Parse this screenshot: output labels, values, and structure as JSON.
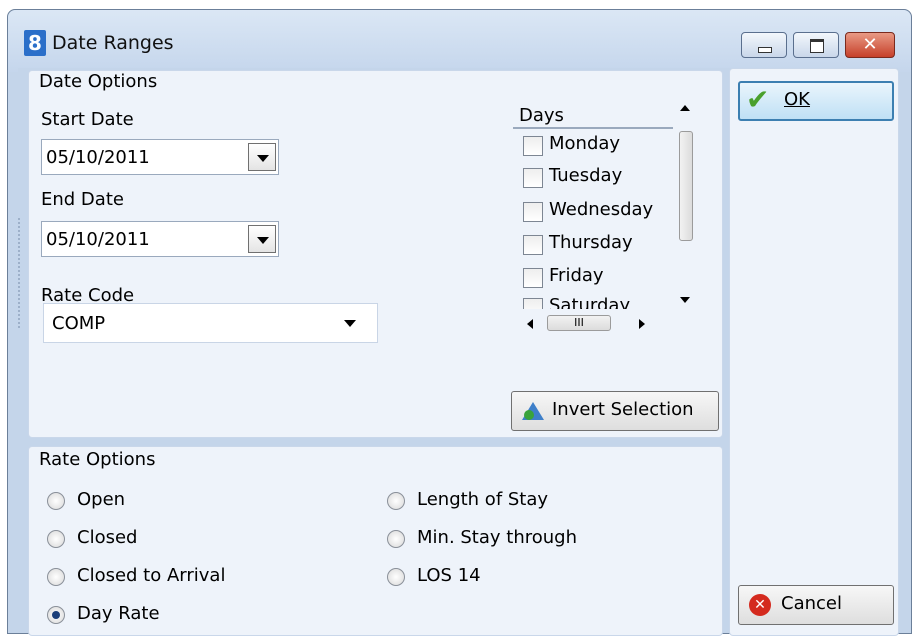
{
  "window": {
    "title": "Date Ranges",
    "icon": "8"
  },
  "date_options": {
    "legend": "Date Options",
    "start_date_label": "Start Date",
    "start_date_value": "05/10/2011",
    "end_date_label": "End Date",
    "end_date_value": "05/10/2011",
    "rate_code_label": "Rate Code",
    "rate_code_value": "COMP"
  },
  "days": {
    "header": "Days",
    "items": [
      {
        "label": "Monday",
        "checked": false
      },
      {
        "label": "Tuesday",
        "checked": false
      },
      {
        "label": "Wednesday",
        "checked": false
      },
      {
        "label": "Thursday",
        "checked": false
      },
      {
        "label": "Friday",
        "checked": false
      },
      {
        "label": "Saturday",
        "checked": false
      }
    ],
    "invert_label": "Invert Selection",
    "hscroll_thumb": "III"
  },
  "rate_options": {
    "legend": "Rate Options",
    "options": [
      {
        "label": "Open",
        "selected": false
      },
      {
        "label": "Closed",
        "selected": false
      },
      {
        "label": "Closed to Arrival",
        "selected": false
      },
      {
        "label": "Day Rate",
        "selected": true
      },
      {
        "label": "Length of Stay",
        "selected": false
      },
      {
        "label": "Min. Stay through",
        "selected": false
      },
      {
        "label": "LOS 14",
        "selected": false
      }
    ]
  },
  "actions": {
    "ok_label": "OK",
    "cancel_label": "Cancel"
  },
  "colors": {
    "frame": "#c4d5ea",
    "panel": "#eef3fa",
    "ok_border": "#3c7fb1",
    "check": "#4aa02c",
    "cancel": "#d42a1e"
  }
}
